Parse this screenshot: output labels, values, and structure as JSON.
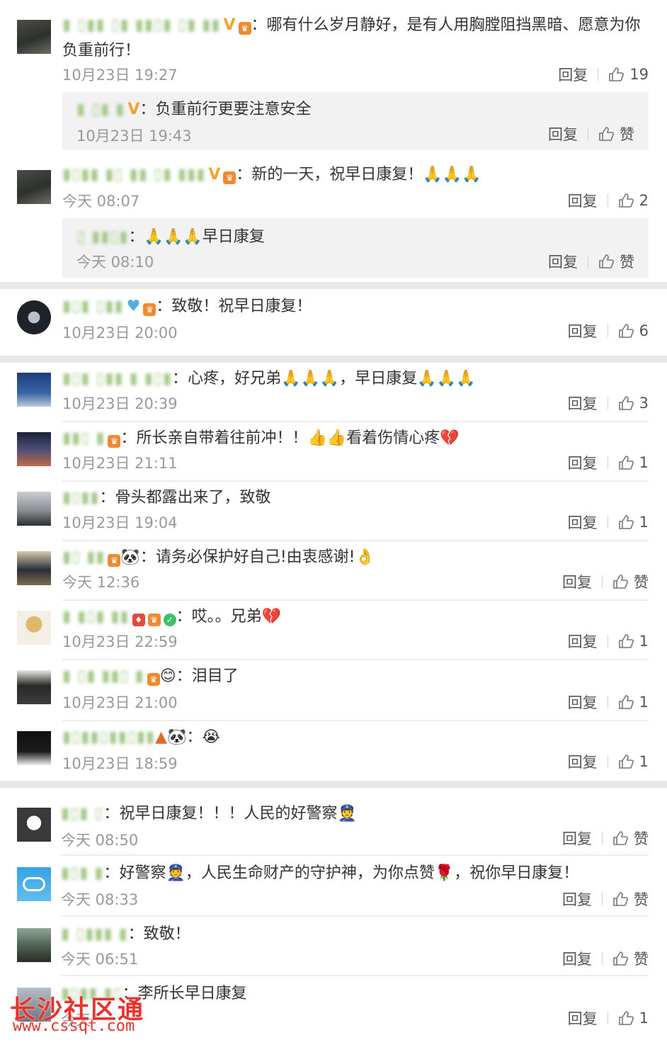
{
  "labels": {
    "reply": "回复",
    "like": "赞"
  },
  "comments": [
    {
      "username": "▮ ▯▮▮ ▯▮ ▮▮▯▮ ▯▮ ▮▮",
      "badges": [
        "V",
        "gold"
      ],
      "text": "哪有什么岁月静好，是有人用胸膛阻挡黑暗、愿意为你负重前行！",
      "time": "10月23日 19:27",
      "likes": "19",
      "reply": {
        "username": "▮ ▯▮ ▮",
        "badges": [
          "V"
        ],
        "text": "负重前行更要注意安全",
        "time": "10月23日 19:43",
        "likes": "赞"
      }
    },
    {
      "username": "▮▯▮▮ ▮▯ ▮▮ ▯▮ ▮▮▮",
      "badges": [
        "V",
        "gold"
      ],
      "text": "新的一天，祝早日康复！🙏🙏🙏",
      "time": "今天 08:07",
      "likes": "2",
      "reply": {
        "username": "▯ ▮▮▯▮",
        "badges": [
          "🐼"
        ],
        "text": "🙏🙏🙏早日康复",
        "time": "今天 08:10",
        "likes": "赞"
      }
    },
    {
      "username": "▮▯▮ ▯▮▮",
      "badges": [
        "blue",
        "gold"
      ],
      "text": "致敬！祝早日康复！",
      "time": "10月23日 20:00",
      "likes": "6"
    },
    {
      "username": "▮▯▮ ▯▮▮ ▮ ▮▯▮",
      "badges": [],
      "text": "心疼，好兄弟🙏🙏🙏，早日康复🙏🙏🙏",
      "time": "10月23日 20:39",
      "likes": "3"
    },
    {
      "username": "▮▮▯ ▮",
      "badges": [
        "gold"
      ],
      "text": "所长亲自带着往前冲！！👍👍看着伤情心疼💔",
      "time": "10月23日 21:11",
      "likes": "1"
    },
    {
      "username": "▮▯▮▮",
      "badges": [],
      "text": "骨头都露出来了，致敬",
      "time": "10月23日 19:04",
      "likes": "1"
    },
    {
      "username": "▮▯ ▮▮",
      "badges": [
        "gold",
        "🐼"
      ],
      "text": "请务必保护好自己!由衷感谢!👌",
      "time": "今天 12:36",
      "likes": "赞"
    },
    {
      "username": "▮ ▮▯▮ ▮▮",
      "badges": [
        "red",
        "gold",
        "green"
      ],
      "text": "哎。。兄弟💔",
      "time": "10月23日 22:59",
      "likes": "1"
    },
    {
      "username": "▮ ▯▮ ▮▮▯ ▮",
      "badges": [
        "gold",
        "😊"
      ],
      "text": "泪目了",
      "time": "10月23日 21:00",
      "likes": "1"
    },
    {
      "username": "▮▯▮▮▯▮▮▯▮▮",
      "badges": [
        "cone",
        "🐼"
      ],
      "text": "😭",
      "time": "10月23日 18:59",
      "likes": "1"
    },
    {
      "username": "▮▯▮ ▯",
      "badges": [],
      "text": "祝早日康复！！！人民的好警察👮",
      "time": "今天 08:50",
      "likes": "赞"
    },
    {
      "username": "▮▯▮ ▮",
      "badges": [],
      "text": "好警察👮，人民生命财产的守护神，为你点赞🌹，祝你早日康复！",
      "time": "今天 08:33",
      "likes": "赞"
    },
    {
      "username": "▮ ▯▮▮▮ ▮",
      "badges": [],
      "text": "致敬！",
      "time": "今天 06:51",
      "likes": "赞"
    },
    {
      "username": "▮▯▮▮ ▮▯",
      "badges": [],
      "text": "李所长早日康复",
      "time": "今天",
      "likes": "1"
    }
  ],
  "watermark": {
    "title": "长沙社区通",
    "url": "www.cssqt.com"
  },
  "colors": {
    "accent_v": "#f3a331",
    "watermark": "#e8332c",
    "meta": "#999999",
    "subbg": "#f2f2f2"
  }
}
